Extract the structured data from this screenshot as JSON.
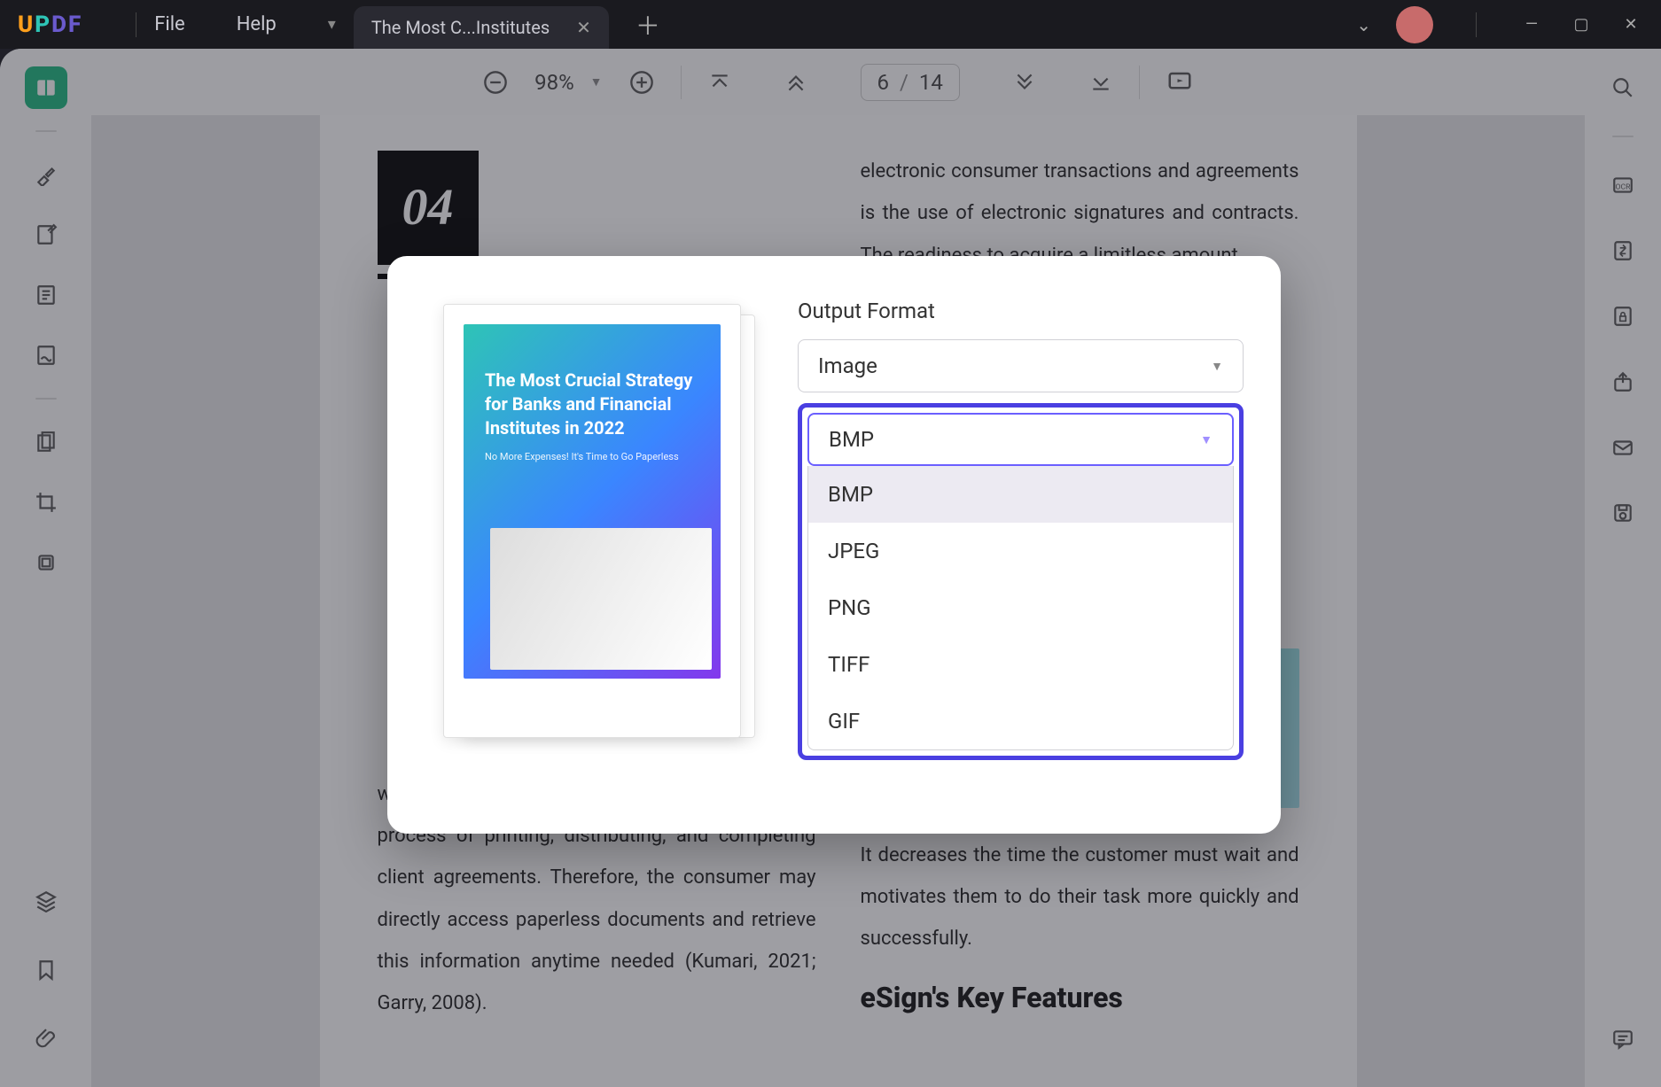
{
  "titlebar": {
    "menu_file": "File",
    "menu_help": "Help",
    "tab_title": "The Most C...Institutes"
  },
  "toolbar": {
    "zoom": "98%",
    "page_current": "6",
    "page_total": "14"
  },
  "document": {
    "section_number": "04",
    "left_text_bottom": "workers, this results in the lengthy and expensive process of printing, distributing, and completing client agreements. Therefore, the consumer may directly access paperless documents and retrieve this information anytime needed (Kumari, 2021; Garry, 2008).",
    "right_text_top": "electronic consumer transactions and agreements is the use of electronic signatures and contracts. The readiness to acquire a limitless amount",
    "right_text_mid": "It decreases the time the customer must wait and motivates them to do their task more quickly and successfully.",
    "key_features_heading": "eSign's Key Features"
  },
  "modal": {
    "preview_title": "The Most Crucial Strategy for Banks and Financial Institutes in 2022",
    "preview_subtitle": "No More Expenses! It's Time to Go Paperless",
    "output_format_label": "Output Format",
    "output_format_value": "Image",
    "image_format_selected": "BMP",
    "image_format_options": [
      "BMP",
      "JPEG",
      "PNG",
      "TIFF",
      "GIF"
    ]
  }
}
